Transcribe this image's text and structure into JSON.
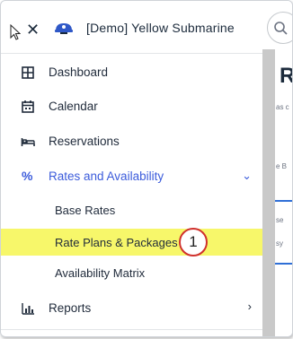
{
  "header": {
    "title": "[Demo] Yellow Submarine",
    "close_icon": "close-icon",
    "logo_icon": "submarine-logo-icon"
  },
  "nav": {
    "dashboard": "Dashboard",
    "calendar": "Calendar",
    "reservations": "Reservations",
    "rates": "Rates and Availability",
    "reports": "Reports"
  },
  "subnav": {
    "base_rates": "Base Rates",
    "rate_plans": "Rate Plans & Packages",
    "availability_matrix": "Availability Matrix"
  },
  "annotation": {
    "step": "1"
  },
  "background": {
    "heading": "R",
    "snippets": [
      "as c",
      "e B",
      "se",
      "sy"
    ]
  },
  "colors": {
    "accent": "#3b5bdb",
    "highlight": "#f7f76a",
    "callout": "#d0312d"
  }
}
